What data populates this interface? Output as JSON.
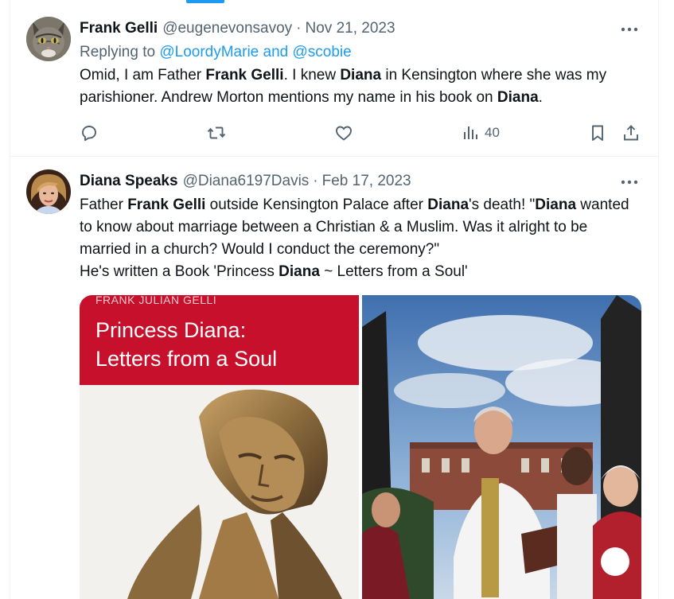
{
  "tweets": [
    {
      "name": "Frank Gelli",
      "handle": "@eugenevonsavoy",
      "date": "Nov 21, 2023",
      "reply_prefix": "Replying to",
      "reply_targets": "@LoordyMarie and @scobie",
      "text_parts": [
        "Omid, I am Father ",
        "Frank Gelli",
        ". I knew ",
        "Diana",
        " in Kensington where she was my parishioner. Andrew Morton mentions my name in his book on ",
        "Diana",
        "."
      ],
      "views": "40",
      "icons": [
        "cat-avatar",
        "more-icon",
        "reply-icon",
        "retweet-icon",
        "like-icon",
        "views-icon",
        "bookmark-icon",
        "share-icon"
      ]
    },
    {
      "name": "Diana Speaks",
      "handle": "@Diana6197Davis",
      "date": "Feb 17, 2023",
      "text_parts": [
        "Father ",
        "Frank Gelli",
        " outside Kensington Palace after ",
        "Diana",
        "'s death! \"",
        "Diana",
        " wanted to know about marriage between a Christian & a Muslim. Was it alright to be married in a church? Would I conduct the ceremony?\"",
        "He's written a Book 'Princess ",
        "Diana",
        " ~ Letters from a Soul'"
      ],
      "media": {
        "book_author": "FRANK JULIAN GELLI",
        "book_title_line1": "Princess Diana:",
        "book_title_line2": "Letters from a Soul"
      }
    }
  ],
  "colors": {
    "text": "#0f1419",
    "muted": "#536471",
    "link": "#1d9bf0",
    "divider": "#eff3f4",
    "book_red": "#c7102c"
  }
}
